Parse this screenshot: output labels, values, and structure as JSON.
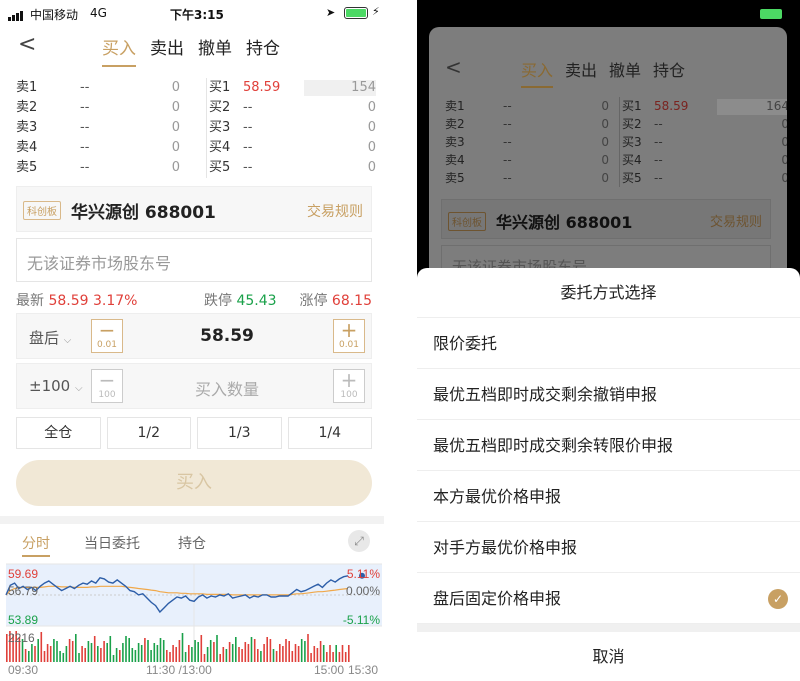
{
  "status": {
    "carrier": "中国移动",
    "network": "4G",
    "time": "下午3:15"
  },
  "nav": {
    "tabs": [
      "买入",
      "卖出",
      "撤单",
      "持仓"
    ],
    "active": 0
  },
  "orderbook": {
    "sell": [
      {
        "label": "卖1",
        "price": "--",
        "vol": "0"
      },
      {
        "label": "卖2",
        "price": "--",
        "vol": "0"
      },
      {
        "label": "卖3",
        "price": "--",
        "vol": "0"
      },
      {
        "label": "卖4",
        "price": "--",
        "vol": "0"
      },
      {
        "label": "卖5",
        "price": "--",
        "vol": "0"
      }
    ],
    "buy": [
      {
        "label": "买1",
        "price": "58.59",
        "vol": "154"
      },
      {
        "label": "买2",
        "price": "--",
        "vol": "0"
      },
      {
        "label": "买3",
        "price": "--",
        "vol": "0"
      },
      {
        "label": "买4",
        "price": "--",
        "vol": "0"
      },
      {
        "label": "买5",
        "price": "--",
        "vol": "0"
      }
    ]
  },
  "stock": {
    "board_tag": "科创板",
    "name": "华兴源创 688001",
    "rules_link": "交易规则"
  },
  "holder": {
    "placeholder": "无该证券市场股东号"
  },
  "quote": {
    "latest_label": "最新",
    "latest": "58.59",
    "change": "3.17%",
    "limit_down_label": "跌停",
    "limit_down": "45.43",
    "limit_up_label": "涨停",
    "limit_up": "68.15"
  },
  "price_row": {
    "mode": "盘后",
    "price": "58.59",
    "step": "0.01"
  },
  "qty_row": {
    "mode": "±100",
    "placeholder": "买入数量",
    "step": "100"
  },
  "fractions": [
    "全仓",
    "1/2",
    "1/3",
    "1/4"
  ],
  "buy_button": "买入",
  "chart_tabs": [
    "分时",
    "当日委托",
    "持仓"
  ],
  "colors": {
    "accent": "#c8a063",
    "up": "#e0403a",
    "down": "#1aa14a"
  },
  "chart_data": {
    "type": "line",
    "y_labels_left": [
      "59.69",
      "56.79",
      "53.89"
    ],
    "y_labels_right": [
      "5.11%",
      "0.00%",
      "-5.11%"
    ],
    "volume_label": "2216",
    "x_labels": [
      "09:30",
      "11:30 /13:00",
      "15:00",
      "15:30"
    ],
    "ylim": [
      53.89,
      59.69
    ],
    "prev_close": 56.79,
    "series": [
      {
        "values": [
          56.8,
          57.7,
          57.9,
          57.4,
          57.6,
          57.3,
          57.5,
          57.2,
          57.6,
          57.9,
          58.1,
          57.8,
          57.5,
          57.2,
          57.4,
          57.6,
          57.4,
          57.7,
          57.9,
          57.8,
          58.1,
          57.9,
          58.4,
          58.3,
          58.0,
          57.9,
          58.2,
          57.9,
          57.6,
          57.2,
          57.1,
          56.8,
          56.9,
          56.5,
          56.1,
          55.8,
          55.2,
          55.6,
          56.0,
          56.3,
          56.6,
          56.5,
          56.7,
          56.3,
          56.2,
          56.6,
          56.8,
          56.5,
          56.7,
          56.6,
          56.8,
          56.7,
          56.9,
          56.5,
          56.6,
          56.7,
          56.8,
          56.5,
          56.7,
          56.6,
          56.8,
          56.8,
          56.6,
          56.6,
          56.7,
          56.7,
          56.7,
          57.0,
          57.3,
          57.1,
          57.2,
          57.4,
          57.6,
          57.8,
          57.5,
          57.9,
          58.2,
          58.0,
          58.3,
          58.5,
          58.59
        ]
      },
      {
        "values": [
          56.8,
          57.2,
          57.4,
          57.45,
          57.5,
          57.5,
          57.5,
          57.5,
          57.5,
          57.55,
          57.6,
          57.6,
          57.6,
          57.55,
          57.55,
          57.55,
          57.5,
          57.5,
          57.5,
          57.5,
          57.55,
          57.55,
          57.6,
          57.6,
          57.6,
          57.6,
          57.6,
          57.6,
          57.55,
          57.5,
          57.45,
          57.4,
          57.35,
          57.3,
          57.25,
          57.2,
          57.1,
          57.05,
          57.0,
          57.0,
          57.0,
          56.95,
          56.95,
          56.9,
          56.9,
          56.9,
          56.9,
          56.85,
          56.85,
          56.85,
          56.85,
          56.85,
          56.85,
          56.8,
          56.8,
          56.8,
          56.8,
          56.8,
          56.8,
          56.8,
          56.8,
          56.8,
          56.8,
          56.8,
          56.8,
          56.8,
          56.8,
          56.85,
          56.9,
          56.9,
          56.95,
          57.0,
          57.05,
          57.1,
          57.1,
          57.15,
          57.2,
          57.25,
          57.3,
          57.35,
          57.4
        ]
      }
    ]
  },
  "modal": {
    "nav_tabs": [
      "买入",
      "卖出",
      "撤单",
      "持仓"
    ],
    "orderbook": {
      "sell": [
        {
          "label": "卖1",
          "price": "--",
          "vol": "0"
        },
        {
          "label": "卖2",
          "price": "--",
          "vol": "0"
        },
        {
          "label": "卖3",
          "price": "--",
          "vol": "0"
        },
        {
          "label": "卖4",
          "price": "--",
          "vol": "0"
        },
        {
          "label": "卖5",
          "price": "--",
          "vol": "0"
        }
      ],
      "buy": [
        {
          "label": "买1",
          "price": "58.59",
          "vol": "164"
        },
        {
          "label": "买2",
          "price": "--",
          "vol": "0"
        },
        {
          "label": "买3",
          "price": "--",
          "vol": "0"
        },
        {
          "label": "买4",
          "price": "--",
          "vol": "0"
        },
        {
          "label": "买5",
          "price": "--",
          "vol": "0"
        }
      ]
    },
    "stock": {
      "board_tag": "科创板",
      "name": "华兴源创 688001",
      "rules_link": "交易规则"
    },
    "holder": {
      "placeholder": "无该证券市场股东号"
    },
    "sheet_title": "委托方式选择",
    "options": [
      "限价委托",
      "最优五档即时成交剩余撤销申报",
      "最优五档即时成交剩余转限价申报",
      "本方最优价格申报",
      "对手方最优价格申报",
      "盘后固定价格申报"
    ],
    "selected_index": 5,
    "cancel": "取消"
  }
}
